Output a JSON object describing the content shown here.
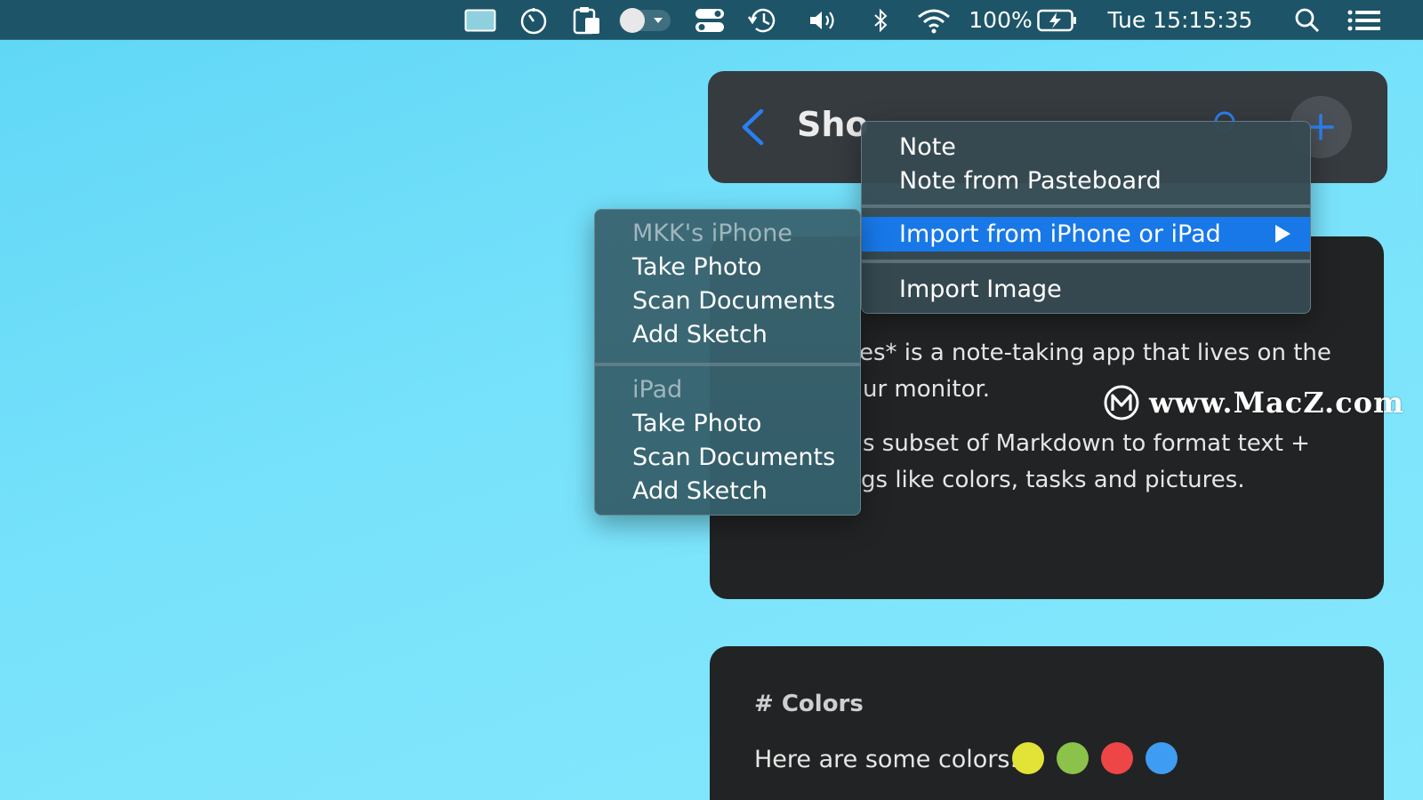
{
  "menubar": {
    "battery": "100%",
    "clock": "Tue 15:15:35",
    "icons": [
      "screen-icon",
      "timer-icon",
      "clipboard-icon",
      "toggle-dropdown-icon",
      "control-center-icon",
      "time-machine-icon",
      "volume-icon",
      "bluetooth-icon",
      "wifi-icon",
      "battery-charging-icon",
      "spotlight-search-icon",
      "menu-list-icon"
    ]
  },
  "header": {
    "title": "Sho"
  },
  "main_menu": {
    "items": [
      {
        "label": "Note"
      },
      {
        "label": "Note from Pasteboard"
      },
      {
        "label": "Import from iPhone or iPad",
        "selected": true,
        "has_submenu": true
      },
      {
        "label": "Import Image"
      }
    ]
  },
  "submenu": {
    "groups": [
      {
        "device": "MKK's iPhone",
        "items": [
          "Take Photo",
          "Scan Documents",
          "Add Sketch"
        ]
      },
      {
        "device": "iPad",
        "items": [
          "Take Photo",
          "Scan Documents",
          "Add Sketch"
        ]
      }
    ]
  },
  "note": {
    "lines": [
      "es* is a note-taking app that lives on the",
      "ur monitor.",
      "s subset of Markdown to format text +",
      "gs like colors, tasks and pictures."
    ]
  },
  "watermark": "www.MacZ.com",
  "colors_note": {
    "heading": "# Colors",
    "text": "Here are some colors:",
    "swatches": [
      "#e3e337",
      "#8bc24a",
      "#ee4646",
      "#3e9df2"
    ]
  },
  "colors": {
    "selection": "#1878e8",
    "accent": "#1e90ff"
  }
}
